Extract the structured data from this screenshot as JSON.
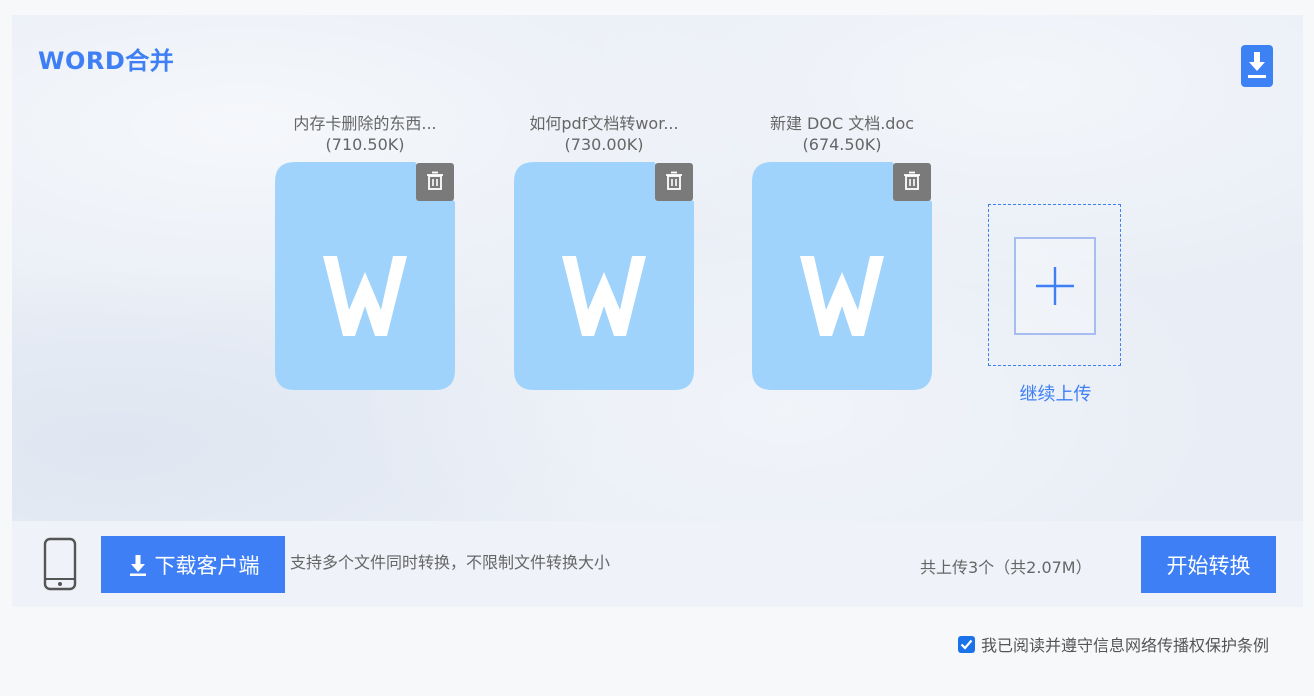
{
  "header": {
    "title": "WORD合并",
    "download_icon": "download-icon"
  },
  "files": [
    {
      "name": "内存卡删除的东西...",
      "size": "(710.50K)",
      "icon": "word-file-icon",
      "delete_icon": "trash-icon"
    },
    {
      "name": "如何pdf文档转wor...",
      "size": "(730.00K)",
      "icon": "word-file-icon",
      "delete_icon": "trash-icon"
    },
    {
      "name": "新建 DOC 文档.doc",
      "size": "(674.50K)",
      "icon": "word-file-icon",
      "delete_icon": "trash-icon"
    }
  ],
  "upload_more": {
    "label": "继续上传",
    "icon": "plus-icon"
  },
  "footer": {
    "phone_icon": "phone-icon",
    "client_button_label": "下载客户端",
    "support_text": "支持多个文件同时转换，不限制文件转换大小",
    "total_text": "共上传3个（共2.07M）",
    "start_button_label": "开始转换"
  },
  "agreement": {
    "checked": true,
    "text": "我已阅读并遵守信息网络传播权保护条例"
  },
  "colors": {
    "accent": "#3f7ff5",
    "file_icon": "#9fd3fb",
    "delete_button": "#7a7a7a"
  }
}
